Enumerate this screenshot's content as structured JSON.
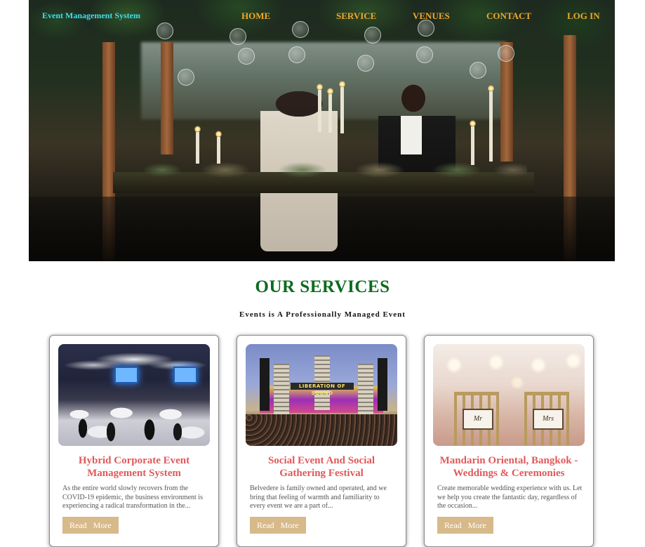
{
  "nav": {
    "brand": "Event Management System",
    "links": [
      "HOME",
      "SERVICE",
      "VENUES",
      "CONTACT",
      "LOG IN"
    ]
  },
  "hero": {
    "image": "wedding-reception-couple-photo"
  },
  "services": {
    "title": "OUR SERVICES",
    "subtitle": "Events is A Professionally Managed Event",
    "cards": [
      {
        "image": "ballroom-corporate-event-photo",
        "title": "Hybrid Corporate Event Management System",
        "description": "As the entire world slowly recovers from the COVID-19 epidemic, the business environment is experiencing a radical transformation in the...",
        "button": "Read More"
      },
      {
        "image": "music-festival-stage-photo",
        "image_banner_text": "LIBERATION OF SOUND",
        "title": "Social Event And Social Gathering Festival",
        "description": "Belvedere is family owned and operated, and we bring that feeling of warmth and familiarity to every event we are a part of...",
        "button": "Read More"
      },
      {
        "image": "wedding-chairs-mr-mrs-photo",
        "image_signs": [
          "Mr",
          "Mrs"
        ],
        "title": "Mandarin Oriental, Bangkok - Weddings & Ceremonies",
        "description": "Create memorable wedding experience with us. Let we help you create the fantastic day, regardless of the occasion...",
        "button": "Read More"
      }
    ]
  },
  "colors": {
    "brand": "#3fe0f0",
    "nav_link": "#f2a72b",
    "services_title": "#0e6b1f",
    "card_title": "#e0595a",
    "button_bg": "#d7b98a"
  }
}
